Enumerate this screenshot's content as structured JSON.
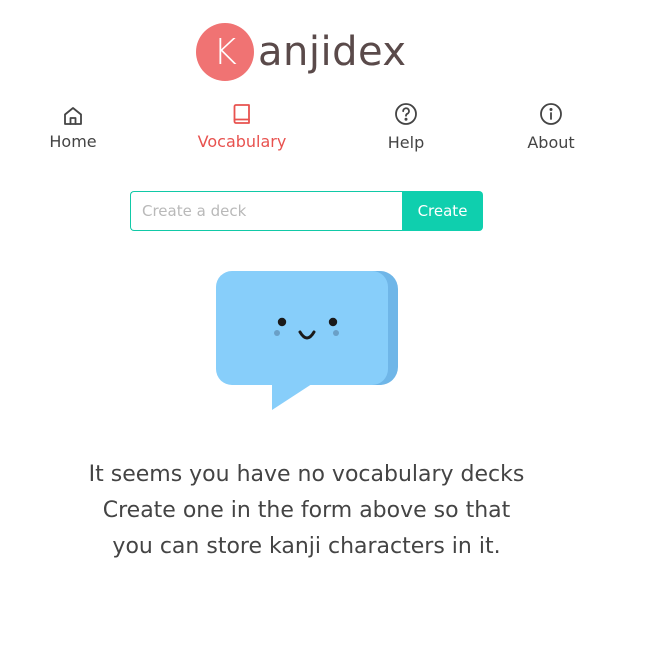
{
  "logo": {
    "badge_letter": "K",
    "rest": "anjidex",
    "badge_color": "#f07373"
  },
  "nav": {
    "items": [
      {
        "label": "Home",
        "icon": "home-icon"
      },
      {
        "label": "Vocabulary",
        "icon": "book-icon",
        "active": true
      },
      {
        "label": "Help",
        "icon": "help-circle-icon"
      },
      {
        "label": "About",
        "icon": "info-circle-icon"
      }
    ],
    "active_color": "#e8524f"
  },
  "form": {
    "placeholder": "Create a deck",
    "value": "",
    "button_label": "Create",
    "accent_color": "#0fcfae"
  },
  "illustration": {
    "icon": "smiling-speech-bubble-illustration",
    "color": "#87cefa"
  },
  "empty_state": {
    "line1": "It seems you have no vocabulary decks",
    "line2": "Create one in the form above so that",
    "line3": "you can store kanji characters in it."
  }
}
